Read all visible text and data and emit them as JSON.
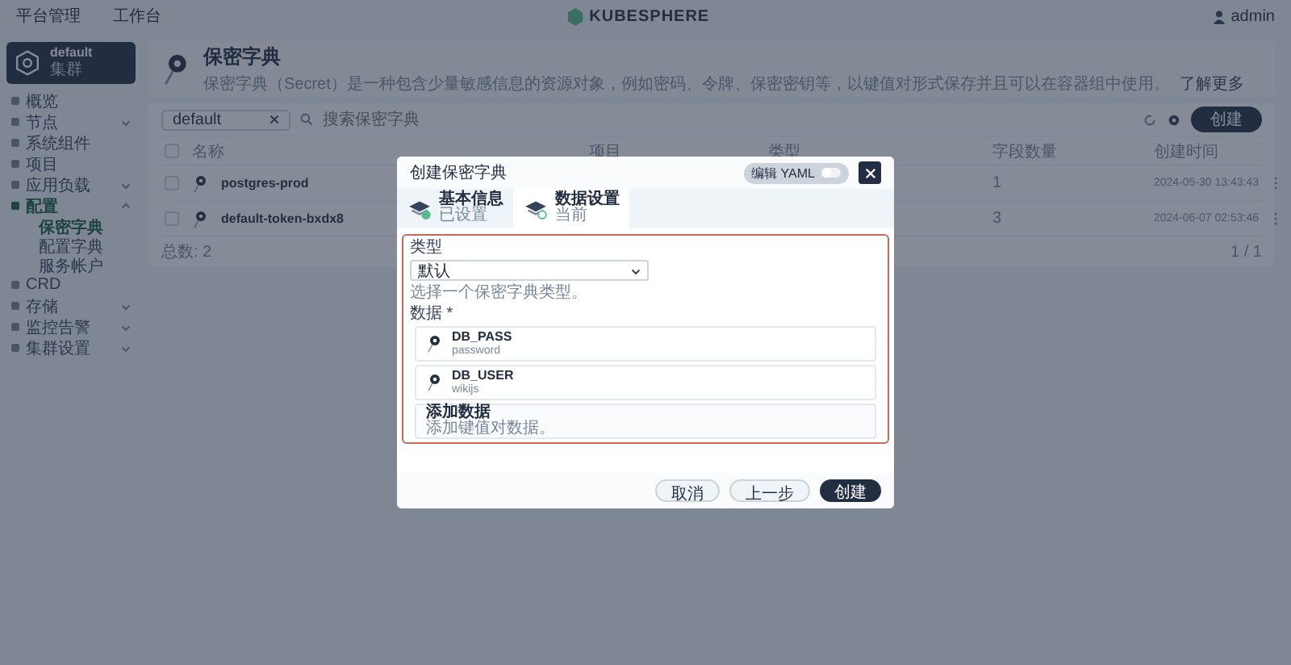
{
  "top_bar": {
    "links": [
      {
        "label": "平台管理"
      },
      {
        "label": "工作台"
      }
    ],
    "logo": "KUBESPHERE",
    "user": "admin"
  },
  "sidebar": {
    "cluster": {
      "name": "default",
      "role": "集群"
    },
    "items": [
      {
        "label": "概览",
        "kind": "link",
        "selected": false
      },
      {
        "label": "节点",
        "kind": "group",
        "expanded": false
      },
      {
        "label": "系统组件",
        "kind": "link",
        "selected": false
      },
      {
        "label": "项目",
        "kind": "link",
        "selected": false
      },
      {
        "label": "应用负载",
        "kind": "group",
        "expanded": false
      },
      {
        "label": "配置",
        "kind": "group",
        "expanded": true,
        "children": [
          {
            "label": "保密字典",
            "selected": true
          },
          {
            "label": "配置字典",
            "selected": false
          },
          {
            "label": "服务帐户",
            "selected": false
          }
        ]
      },
      {
        "label": "CRD",
        "kind": "link",
        "selected": false
      },
      {
        "label": "存储",
        "kind": "group",
        "expanded": false
      },
      {
        "label": "监控告警",
        "kind": "group",
        "expanded": false
      },
      {
        "label": "集群设置",
        "kind": "group",
        "expanded": false
      }
    ]
  },
  "page_header": {
    "title": "保密字典",
    "description": "保密字典（Secret）是一种包含少量敏感信息的资源对象，例如密码、令牌、保密密钥等，以键值对形式保存并且可以在容器组中使用。",
    "learn_more": "了解更多"
  },
  "toolbar": {
    "project_filter": "default",
    "search": {
      "placeholder": "搜索保密字典"
    },
    "create_button": "创建"
  },
  "table": {
    "select_all": {
      "checked": false
    },
    "columns": [
      "名称",
      "项目",
      "类型",
      "字段数量",
      "创建时间"
    ],
    "rows": [
      {
        "name": "postgres-prod",
        "fields": "1",
        "created": "2024-05-30 13:43:43",
        "selected": false
      },
      {
        "name": "default-token-bxdx8",
        "fields": "3",
        "created": "2024-06-07 02:53:46",
        "selected": false
      }
    ],
    "total": "总数: 2",
    "page": "1 / 1"
  },
  "dialog": {
    "title": "创建保密字典",
    "yaml_toggle": {
      "label": "编辑 YAML",
      "on": false
    },
    "steps": [
      {
        "title": "基本信息",
        "status": "已设置",
        "selected": false,
        "done": true
      },
      {
        "title": "数据设置",
        "status": "当前",
        "selected": true,
        "done": false
      }
    ],
    "type_label": "类型",
    "type_value": "默认",
    "type_hint": "选择一个保密字典类型。",
    "data_label": "数据 *",
    "entries": [
      {
        "key": "DB_PASS",
        "value": "password"
      },
      {
        "key": "DB_USER",
        "value": "wikijs"
      }
    ],
    "add": {
      "title": "添加数据",
      "hint": "添加键值对数据。"
    },
    "buttons": [
      {
        "label": "取消",
        "kind": "plain"
      },
      {
        "label": "上一步",
        "kind": "plain"
      },
      {
        "label": "创建",
        "kind": "primary"
      }
    ]
  }
}
